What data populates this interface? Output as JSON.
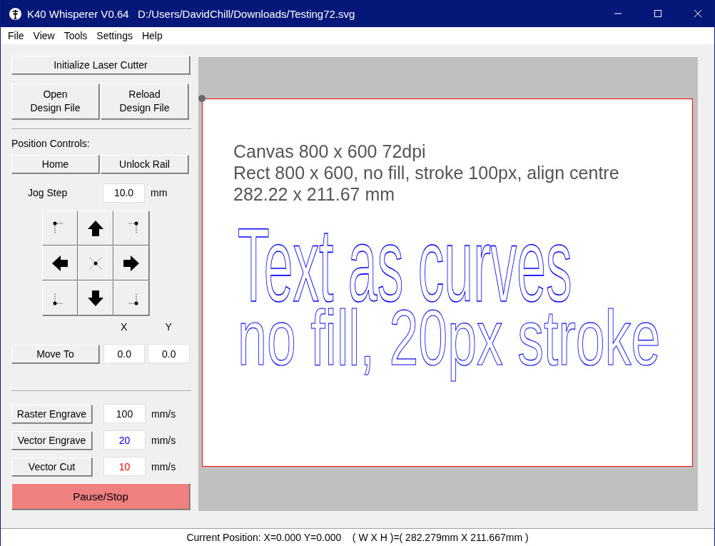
{
  "window": {
    "title": "K40 Whisperer V0.64   D:/Users/DavidChill/Downloads/Testing72.svg"
  },
  "menu": [
    "File",
    "View",
    "Tools",
    "Settings",
    "Help"
  ],
  "initialize_button": "Initialize Laser Cutter",
  "file_buttons": [
    {
      "line1": "Open",
      "line2": "Design File"
    },
    {
      "line1": "Reload",
      "line2": "Design File"
    }
  ],
  "position_label": "Position Controls:",
  "position_buttons": [
    "Home",
    "Unlock Rail"
  ],
  "jog_step": {
    "label": "Jog Step",
    "value": "10.0",
    "unit": "mm"
  },
  "move_to": {
    "button": "Move To",
    "x_label": "X",
    "y_label": "Y",
    "x_value": "0.0",
    "y_value": "0.0"
  },
  "speeds": [
    {
      "button": "Raster Engrave",
      "value": "100",
      "unit": "mm/s",
      "color": "#000000"
    },
    {
      "button": "Vector Engrave",
      "value": "20",
      "unit": "mm/s",
      "color": "#0000ff"
    },
    {
      "button": "Vector Cut",
      "value": "10",
      "unit": "mm/s",
      "color": "#ff0000"
    }
  ],
  "pause_button": "Pause/Stop",
  "canvas": {
    "notes": [
      "Canvas 800 x 600 72dpi",
      "Rect 800 x 600, no fill, stroke 100px, align centre",
      "282.22  x 211.67 mm"
    ],
    "outlined_text": [
      "Text as curves",
      "no fill, 20px stroke"
    ]
  },
  "status_bar": "Current Position: X=0.000 Y=0.000    ( W X H )=( 282.279mm X 211.667mm )"
}
